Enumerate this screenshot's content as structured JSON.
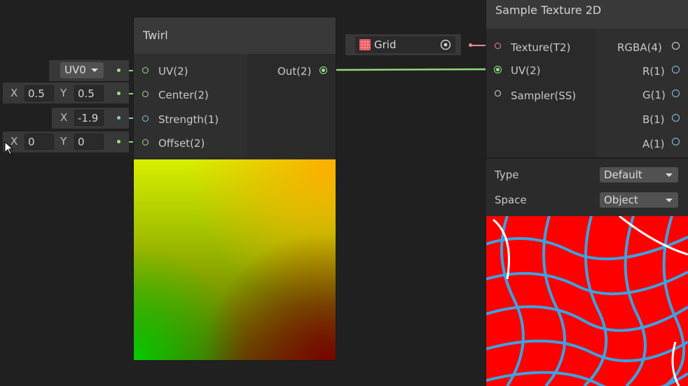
{
  "twirl": {
    "title": "Twirl",
    "inputs": [
      "UV(2)",
      "Center(2)",
      "Strength(1)",
      "Offset(2)"
    ],
    "output": "Out(2)"
  },
  "inputs_left": {
    "uv_dropdown": "UV0",
    "center": {
      "x_label": "X",
      "x": "0.5",
      "y_label": "Y",
      "y": "0.5"
    },
    "strength": {
      "x_label": "X",
      "x": "-1.9"
    },
    "offset": {
      "x_label": "X",
      "x": "0",
      "y_label": "Y",
      "y": "0"
    }
  },
  "grid_node": {
    "label": "Grid"
  },
  "sample_texture": {
    "title": "Sample Texture 2D",
    "inputs": [
      "Texture(T2)",
      "UV(2)",
      "Sampler(SS)"
    ],
    "outputs": [
      "RGBA(4)",
      "R(1)",
      "G(1)",
      "B(1)",
      "A(1)"
    ],
    "type_label": "Type",
    "type_value": "Default",
    "space_label": "Space",
    "space_value": "Object"
  },
  "colors": {
    "uv_wire": "#8fd97c",
    "float_wire": "#84c6e6",
    "texture_wire": "#f08a8a",
    "texture_red": "#ff0000",
    "texture_lines": "#3aa3e0"
  }
}
